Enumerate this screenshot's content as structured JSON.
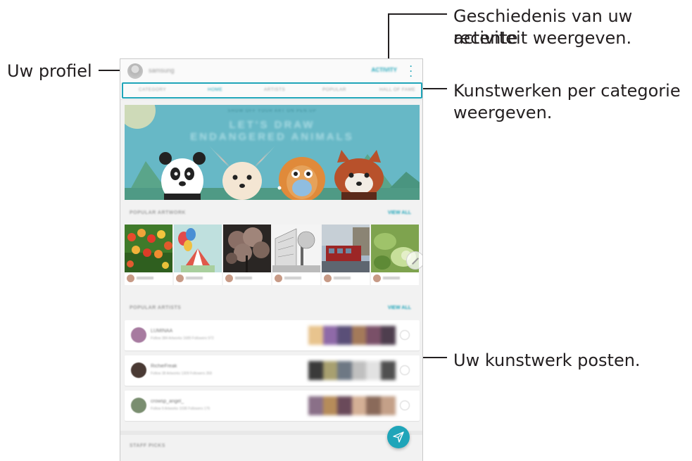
{
  "callouts": {
    "profile": "Uw profiel",
    "history_line1": "Geschiedenis van uw recente",
    "history_line2": "activiteit weergeven.",
    "category_line1": "Kunstwerken per categorie",
    "category_line2": "weergeven.",
    "post": "Uw kunstwerk posten."
  },
  "app": {
    "account_name": "samsung",
    "activity_label": "ACTIVITY",
    "tabs": [
      "CATEGORY",
      "HOME",
      "ARTISTS",
      "POPULAR",
      "HALL OF FAME"
    ],
    "active_tab": "HOME",
    "banner": {
      "subtitle": "SHOW OFF YOUR ART ON PEN.UP",
      "title_line1": "LET'S DRAW",
      "title_line2": "ENDANGERED ANIMALS"
    },
    "sections": {
      "popular_artwork": "POPULAR ARTWORK",
      "popular_artists": "POPULAR ARTISTS",
      "staff_picks": "STAFF PICKS",
      "view_all": "VIEW ALL"
    },
    "artwork_subjects": [
      "tulips",
      "balloons",
      "blossom-tree",
      "street-sketch",
      "red-tram",
      "green-leaves"
    ],
    "artists": [
      {
        "name": "LUMINAA",
        "info": "Follow 384 Artworks 1689 Followers 972"
      },
      {
        "name": "RichieFreak",
        "info": "Follow 38 Artworks 1309 Followers 358"
      },
      {
        "name": "crowsp_angel_",
        "info": "Follow 9 Artworks 1038 Followers 176"
      }
    ]
  },
  "colors": {
    "accent": "#1fa5b9",
    "banner_sky": "#67b8c6",
    "text": "#231f20"
  }
}
